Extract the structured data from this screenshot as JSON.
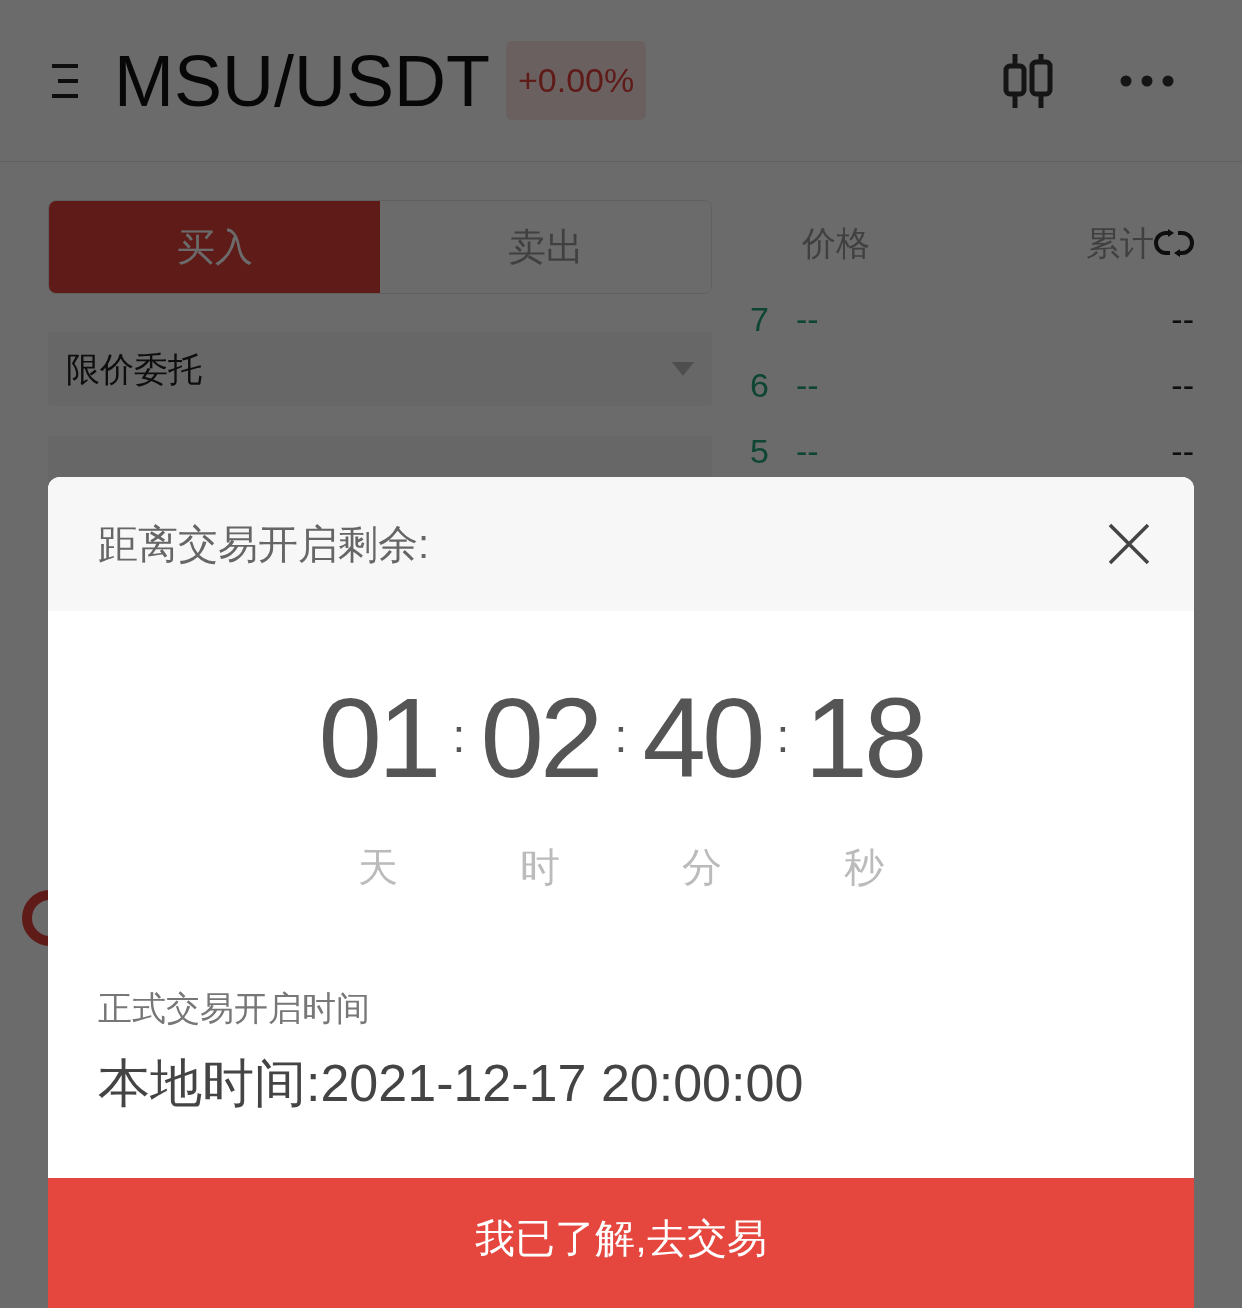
{
  "header": {
    "pair": "MSU/USDT",
    "change": "+0.00%"
  },
  "trade_tabs": [
    {
      "label": "买入",
      "selected": true
    },
    {
      "label": "卖出",
      "selected": false
    }
  ],
  "order_type": {
    "value": "限价委托"
  },
  "order_book": {
    "columns": [
      "价格",
      "累计"
    ],
    "rows": [
      {
        "index": "7",
        "price": "--",
        "total": "--"
      },
      {
        "index": "6",
        "price": "--",
        "total": "--"
      },
      {
        "index": "5",
        "price": "--",
        "total": "--"
      }
    ]
  },
  "modal": {
    "title": "距离交易开启剩余:",
    "countdown": [
      {
        "value": "01",
        "unit": "天",
        "separator": ":"
      },
      {
        "value": "02",
        "unit": "时",
        "separator": ":"
      },
      {
        "value": "40",
        "unit": "分",
        "separator": ":"
      },
      {
        "value": "18",
        "unit": "秒"
      }
    ],
    "open_time_label": "正式交易开启时间",
    "open_time": "本地时间:2021-12-17 20:00:00",
    "confirm_button": "我已了解,去交易"
  }
}
